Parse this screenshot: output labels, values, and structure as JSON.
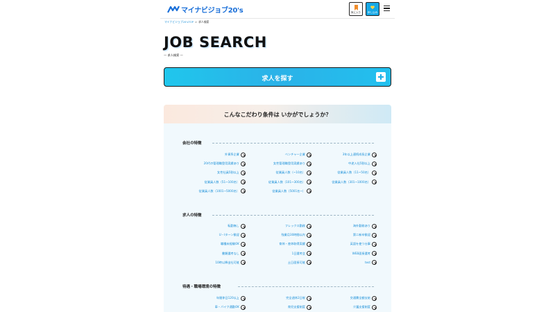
{
  "header": {
    "logo_text": "マイナビジョブ20's",
    "fav_label": "気に入り",
    "apply_label": "申し込み"
  },
  "breadcrumb": {
    "home": "マイナビジョブ20'sTOP",
    "current": "求人検索"
  },
  "title": "JOB SEARCH",
  "subtitle": "— 求人検索 —",
  "search_button": "求人を探す",
  "panel_heading": "こんなこだわり条件は いかがでしょうか？",
  "sections": [
    {
      "title": "会社の特徴",
      "items": [
        [
          "外資系企業",
          "ベンチャー企業",
          "3年以上連続成長企業"
        ],
        [
          "20代の管理職登用実績あり",
          "女性管理職登用実績あり",
          "中途入社5割以上"
        ],
        [
          "女性社員5割以上",
          "従業員人数（~10名）",
          "従業員人数（11~50名）"
        ],
        [
          "従業員人数（51~100名）",
          "従業員人数（101~300名）",
          "従業員人数（301~1000名）"
        ],
        [
          "従業員人数（1001~5000名）",
          "従業員人数（5001名~）"
        ]
      ]
    },
    {
      "title": "求人の特徴",
      "items": [
        [
          "転勤無し",
          "フレックス勤務",
          "海外勤務あり"
        ],
        [
          "U・Iターン歓迎",
          "残業月30時間以内",
          "第二新卒歓迎"
        ],
        [
          "職種未経験OK",
          "育休・産休取得実績",
          "英語を使う仕事"
        ],
        [
          "書類選考なし",
          "1日選考会",
          "WEB面接選考"
        ],
        [
          "10時以降出社可能",
          "土日面接可能",
          "test"
        ]
      ]
    },
    {
      "title": "待遇・職場環境の特徴",
      "items": [
        [
          "年間休日120以上",
          "完全週休2日制",
          "交通費全額支給"
        ],
        [
          "車・バイク通勤OK",
          "育児支援制度",
          "介護支援制度"
        ]
      ]
    }
  ]
}
